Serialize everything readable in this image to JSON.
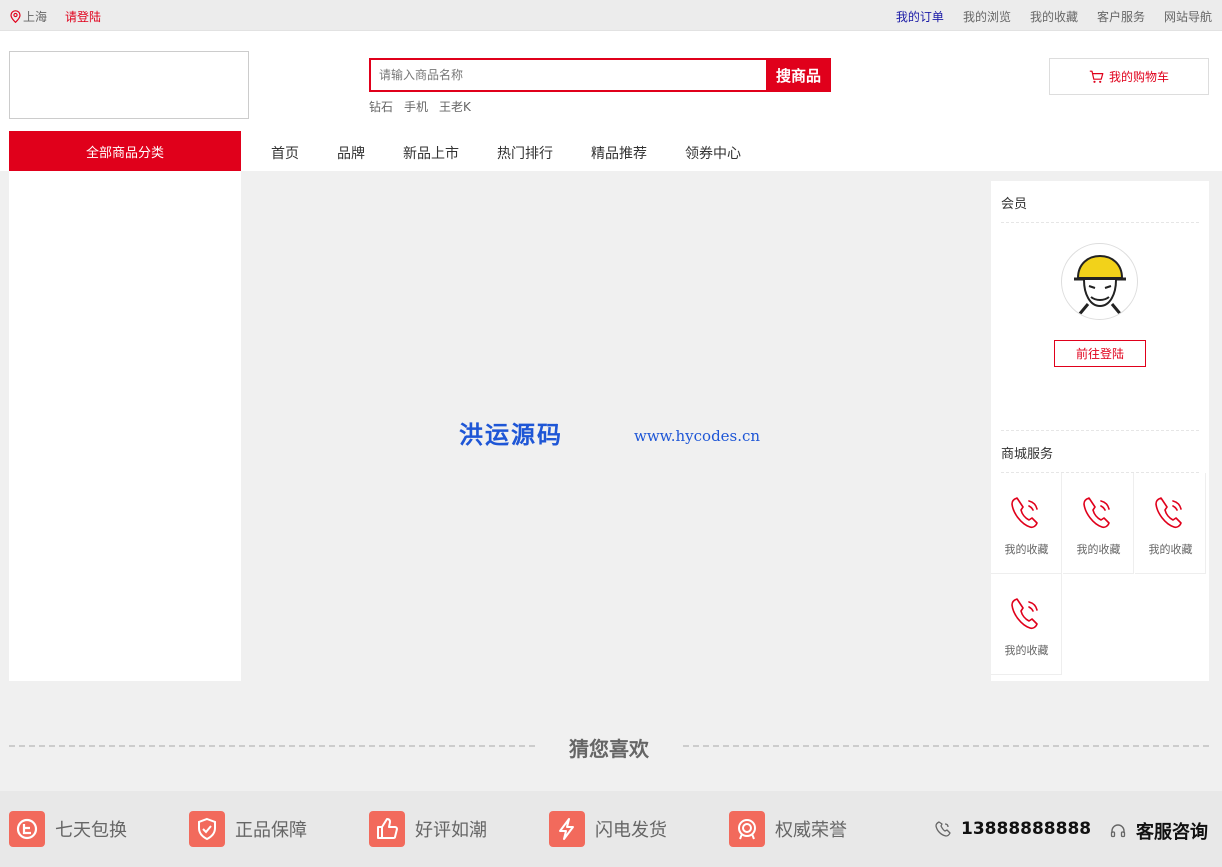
{
  "topbar": {
    "location": "上海",
    "login": "请登陆",
    "links": [
      "我的订单",
      "我的浏览",
      "我的收藏",
      "客户服务",
      "网站导航"
    ]
  },
  "search": {
    "placeholder": "请输入商品名称",
    "button": "搜商品",
    "hot_words": [
      "钻石",
      "手机",
      "王老K"
    ]
  },
  "cart": {
    "label": "我的购物车"
  },
  "nav": {
    "all_categories": "全部商品分类",
    "links": [
      "首页",
      "品牌",
      "新品上市",
      "热门排行",
      "精品推荐",
      "领券中心"
    ]
  },
  "banner": {
    "watermark_cn": "洪运源码",
    "watermark_en": "www.hycodes.cn"
  },
  "sidebar": {
    "member_title": "会员",
    "login_button": "前往登陆",
    "service_title": "商城服务",
    "services": [
      "我的收藏",
      "我的收藏",
      "我的收藏",
      "我的收藏"
    ]
  },
  "guess": {
    "title": "猜您喜欢"
  },
  "features": {
    "items": [
      "七天包换",
      "正品保障",
      "好评如潮",
      "闪电发货",
      "权威荣誉"
    ],
    "phone": "13888888888",
    "consult": "客服咨询"
  },
  "colors": {
    "brand_red": "#e0001b",
    "feature_icon": "#f26a5c",
    "watermark_blue": "#1e56d6"
  }
}
